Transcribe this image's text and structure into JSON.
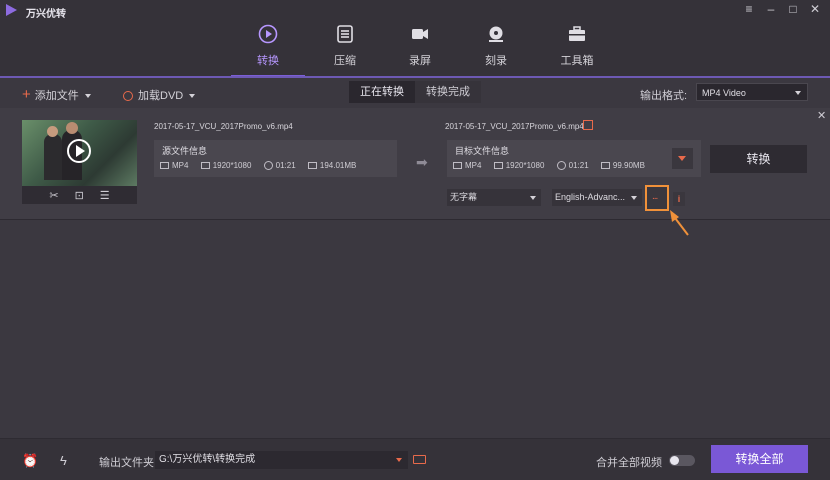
{
  "app": {
    "title": "万兴优转"
  },
  "nav": {
    "tabs": [
      {
        "label": "转换",
        "icon": "play-circle-icon",
        "active": true
      },
      {
        "label": "压缩",
        "icon": "compress-icon",
        "active": false
      },
      {
        "label": "录屏",
        "icon": "camera-icon",
        "active": false
      },
      {
        "label": "刻录",
        "icon": "disc-icon",
        "active": false
      },
      {
        "label": "工具箱",
        "icon": "toolbox-icon",
        "active": false
      }
    ]
  },
  "toolbar": {
    "add_file": "添加文件",
    "load_dvd": "加载DVD",
    "tab_converting": "正在转换",
    "tab_converted": "转换完成",
    "output_format_label": "输出格式:",
    "output_format_value": "MP4 Video"
  },
  "file": {
    "source_name": "2017-05-17_VCU_2017Promo_v6.mp4",
    "target_name": "2017-05-17_VCU_2017Promo_v6.mp4",
    "source": {
      "title": "源文件信息",
      "format": "MP4",
      "resolution": "1920*1080",
      "duration": "01:21",
      "size": "194.01MB"
    },
    "target": {
      "title": "目标文件信息",
      "format": "MP4",
      "resolution": "1920*1080",
      "duration": "01:21",
      "size": "99.90MB"
    },
    "convert_label": "转换",
    "subtitle_value": "无字幕",
    "audio_value": "English-Advanc..."
  },
  "bottom": {
    "output_folder_label": "输出文件夹",
    "output_folder_path": "G:\\万兴优转\\转换完成",
    "merge_label": "合并全部视频",
    "convert_all_label": "转换全部"
  },
  "colors": {
    "accent": "#7a58d6",
    "orange": "#e86a4b",
    "highlight": "#f0913a"
  }
}
